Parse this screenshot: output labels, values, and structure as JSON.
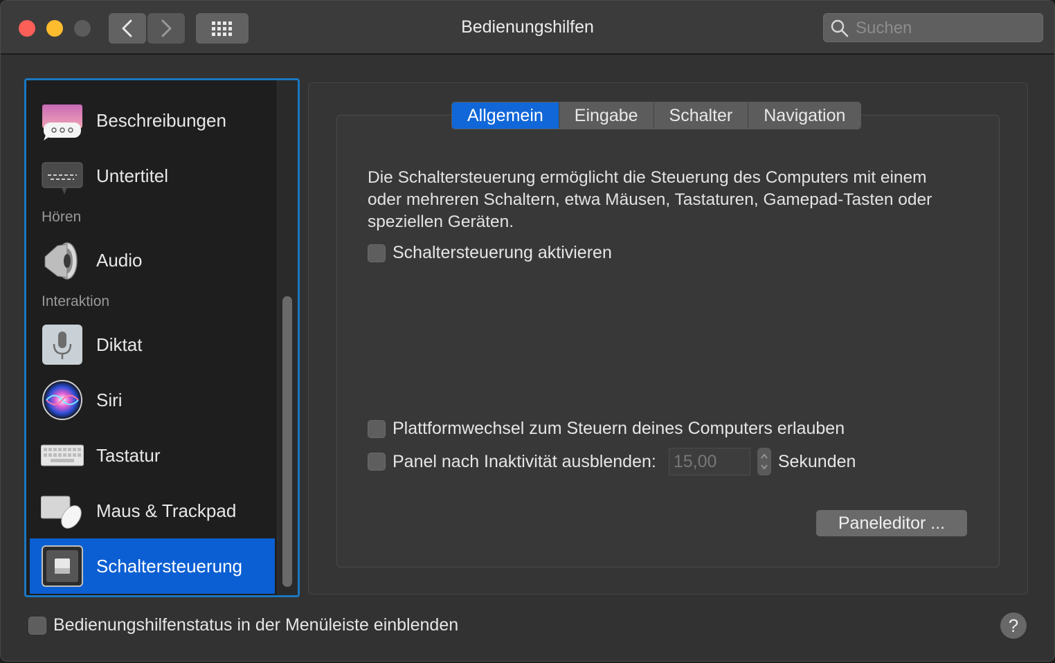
{
  "window": {
    "title": "Bedienungshilfen"
  },
  "search": {
    "placeholder": "Suchen"
  },
  "sidebar": {
    "items": [
      {
        "label": "Beschreibungen",
        "icon": "speech-bubble-icon"
      },
      {
        "label": "Untertitel",
        "icon": "subtitles-icon"
      },
      {
        "label": "Audio",
        "icon": "speaker-icon"
      },
      {
        "label": "Diktat",
        "icon": "microphone-icon"
      },
      {
        "label": "Siri",
        "icon": "siri-icon"
      },
      {
        "label": "Tastatur",
        "icon": "keyboard-icon"
      },
      {
        "label": "Maus & Trackpad",
        "icon": "mouse-trackpad-icon"
      },
      {
        "label": "Schaltersteuerung",
        "icon": "switch-control-icon",
        "selected": true
      }
    ],
    "sections": {
      "hoeren": "Hören",
      "interaktion": "Interaktion"
    }
  },
  "tabs": [
    {
      "label": "Allgemein",
      "active": true
    },
    {
      "label": "Eingabe"
    },
    {
      "label": "Schalter"
    },
    {
      "label": "Navigation"
    }
  ],
  "main": {
    "description": "Die Schaltersteuerung ermöglicht die Steuerung des Computers mit einem oder mehreren Schaltern, etwa Mäusen, Tastaturen, Gamepad-Tasten oder speziellen Geräten.",
    "enable_label": "Schaltersteuerung aktivieren",
    "platform_label": "Plattformwechsel zum Steuern deines Computers erlauben",
    "hide_panel_label": "Panel nach Inaktivität ausblenden:",
    "hide_panel_value": "15,00",
    "hide_panel_unit": "Sekunden",
    "paneleditor_label": "Paneleditor ..."
  },
  "footer": {
    "status_label": "Bedienungshilfenstatus in der Menüleiste einblenden",
    "help_label": "?"
  },
  "colors": {
    "accent": "#0b5fd3",
    "tab_active": "#1167d8",
    "close": "#fc5f57",
    "minimize": "#fdbc2e"
  }
}
